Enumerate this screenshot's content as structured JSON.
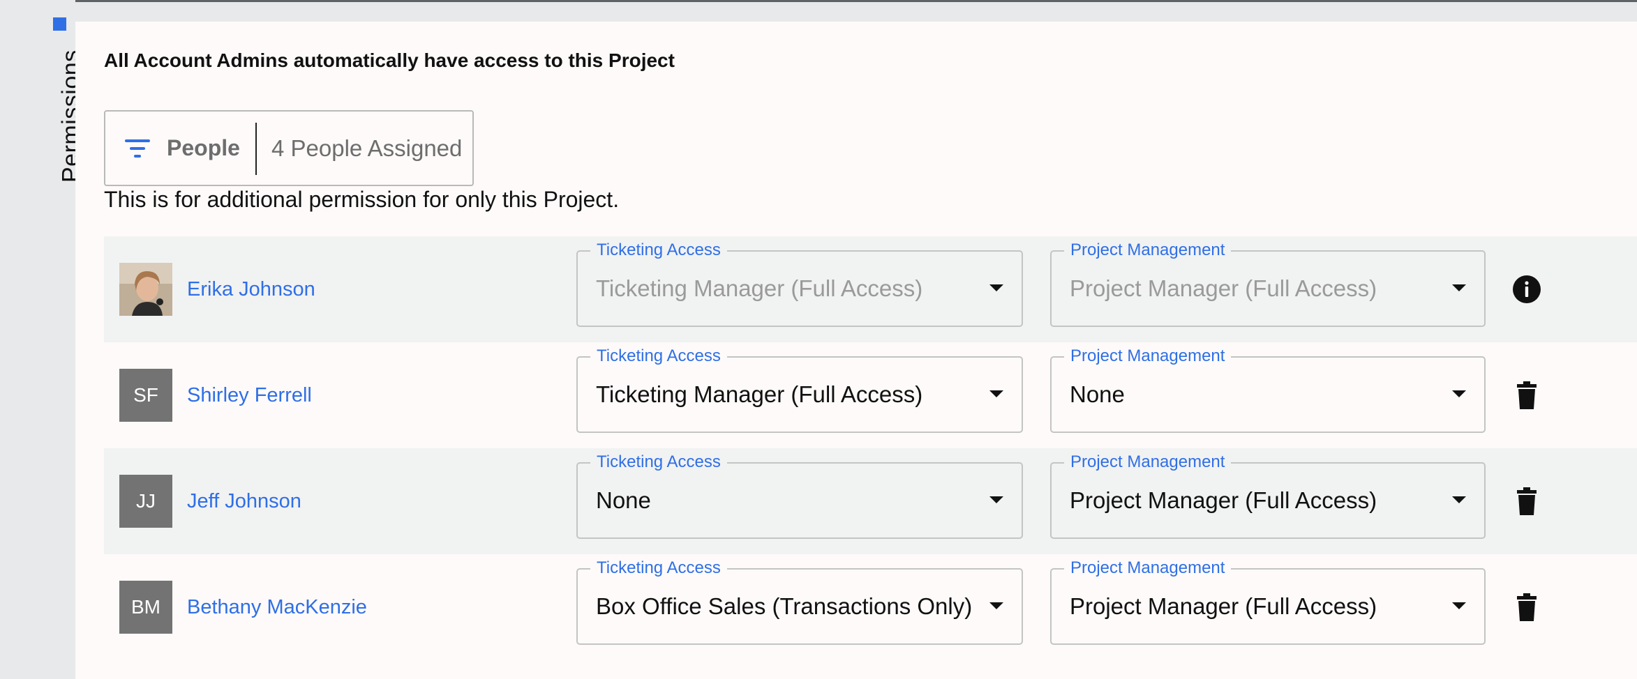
{
  "side_tab": {
    "label": "Permissions",
    "accent": "#2f6fe6"
  },
  "notice": "All Account Admins automatically have access to this Project",
  "filter": {
    "label": "People",
    "count_text": "4 People Assigned",
    "icon": "filter-icon"
  },
  "subtext": "This is for additional permission for only this Project.",
  "rows": [
    {
      "name": "Erika Johnson",
      "initials": "",
      "avatar": "photo",
      "ticketing_label": "Ticketing Access",
      "ticketing_value": "Ticketing Manager (Full Access)",
      "pm_label": "Project Management",
      "pm_value": "Project Manager (Full Access)",
      "disabled": true,
      "action_icon": "info-icon"
    },
    {
      "name": "Shirley Ferrell",
      "initials": "SF",
      "avatar": "initials",
      "ticketing_label": "Ticketing Access",
      "ticketing_value": "Ticketing Manager (Full Access)",
      "pm_label": "Project Management",
      "pm_value": "None",
      "disabled": false,
      "action_icon": "trash-icon"
    },
    {
      "name": "Jeff Johnson",
      "initials": "JJ",
      "avatar": "initials",
      "ticketing_label": "Ticketing Access",
      "ticketing_value": "None",
      "pm_label": "Project Management",
      "pm_value": "Project Manager (Full Access)",
      "disabled": false,
      "action_icon": "trash-icon"
    },
    {
      "name": "Bethany MacKenzie",
      "initials": "BM",
      "avatar": "initials",
      "ticketing_label": "Ticketing Access",
      "ticketing_value": "Box Office Sales (Transactions Only)",
      "pm_label": "Project Management",
      "pm_value": "Project Manager (Full Access)",
      "disabled": false,
      "action_icon": "trash-icon"
    }
  ],
  "colors": {
    "link": "#2f6fe6",
    "avatar_bg": "#737373",
    "row_shade": "#f1f2f2",
    "panel_bg": "#fdfaf9"
  }
}
